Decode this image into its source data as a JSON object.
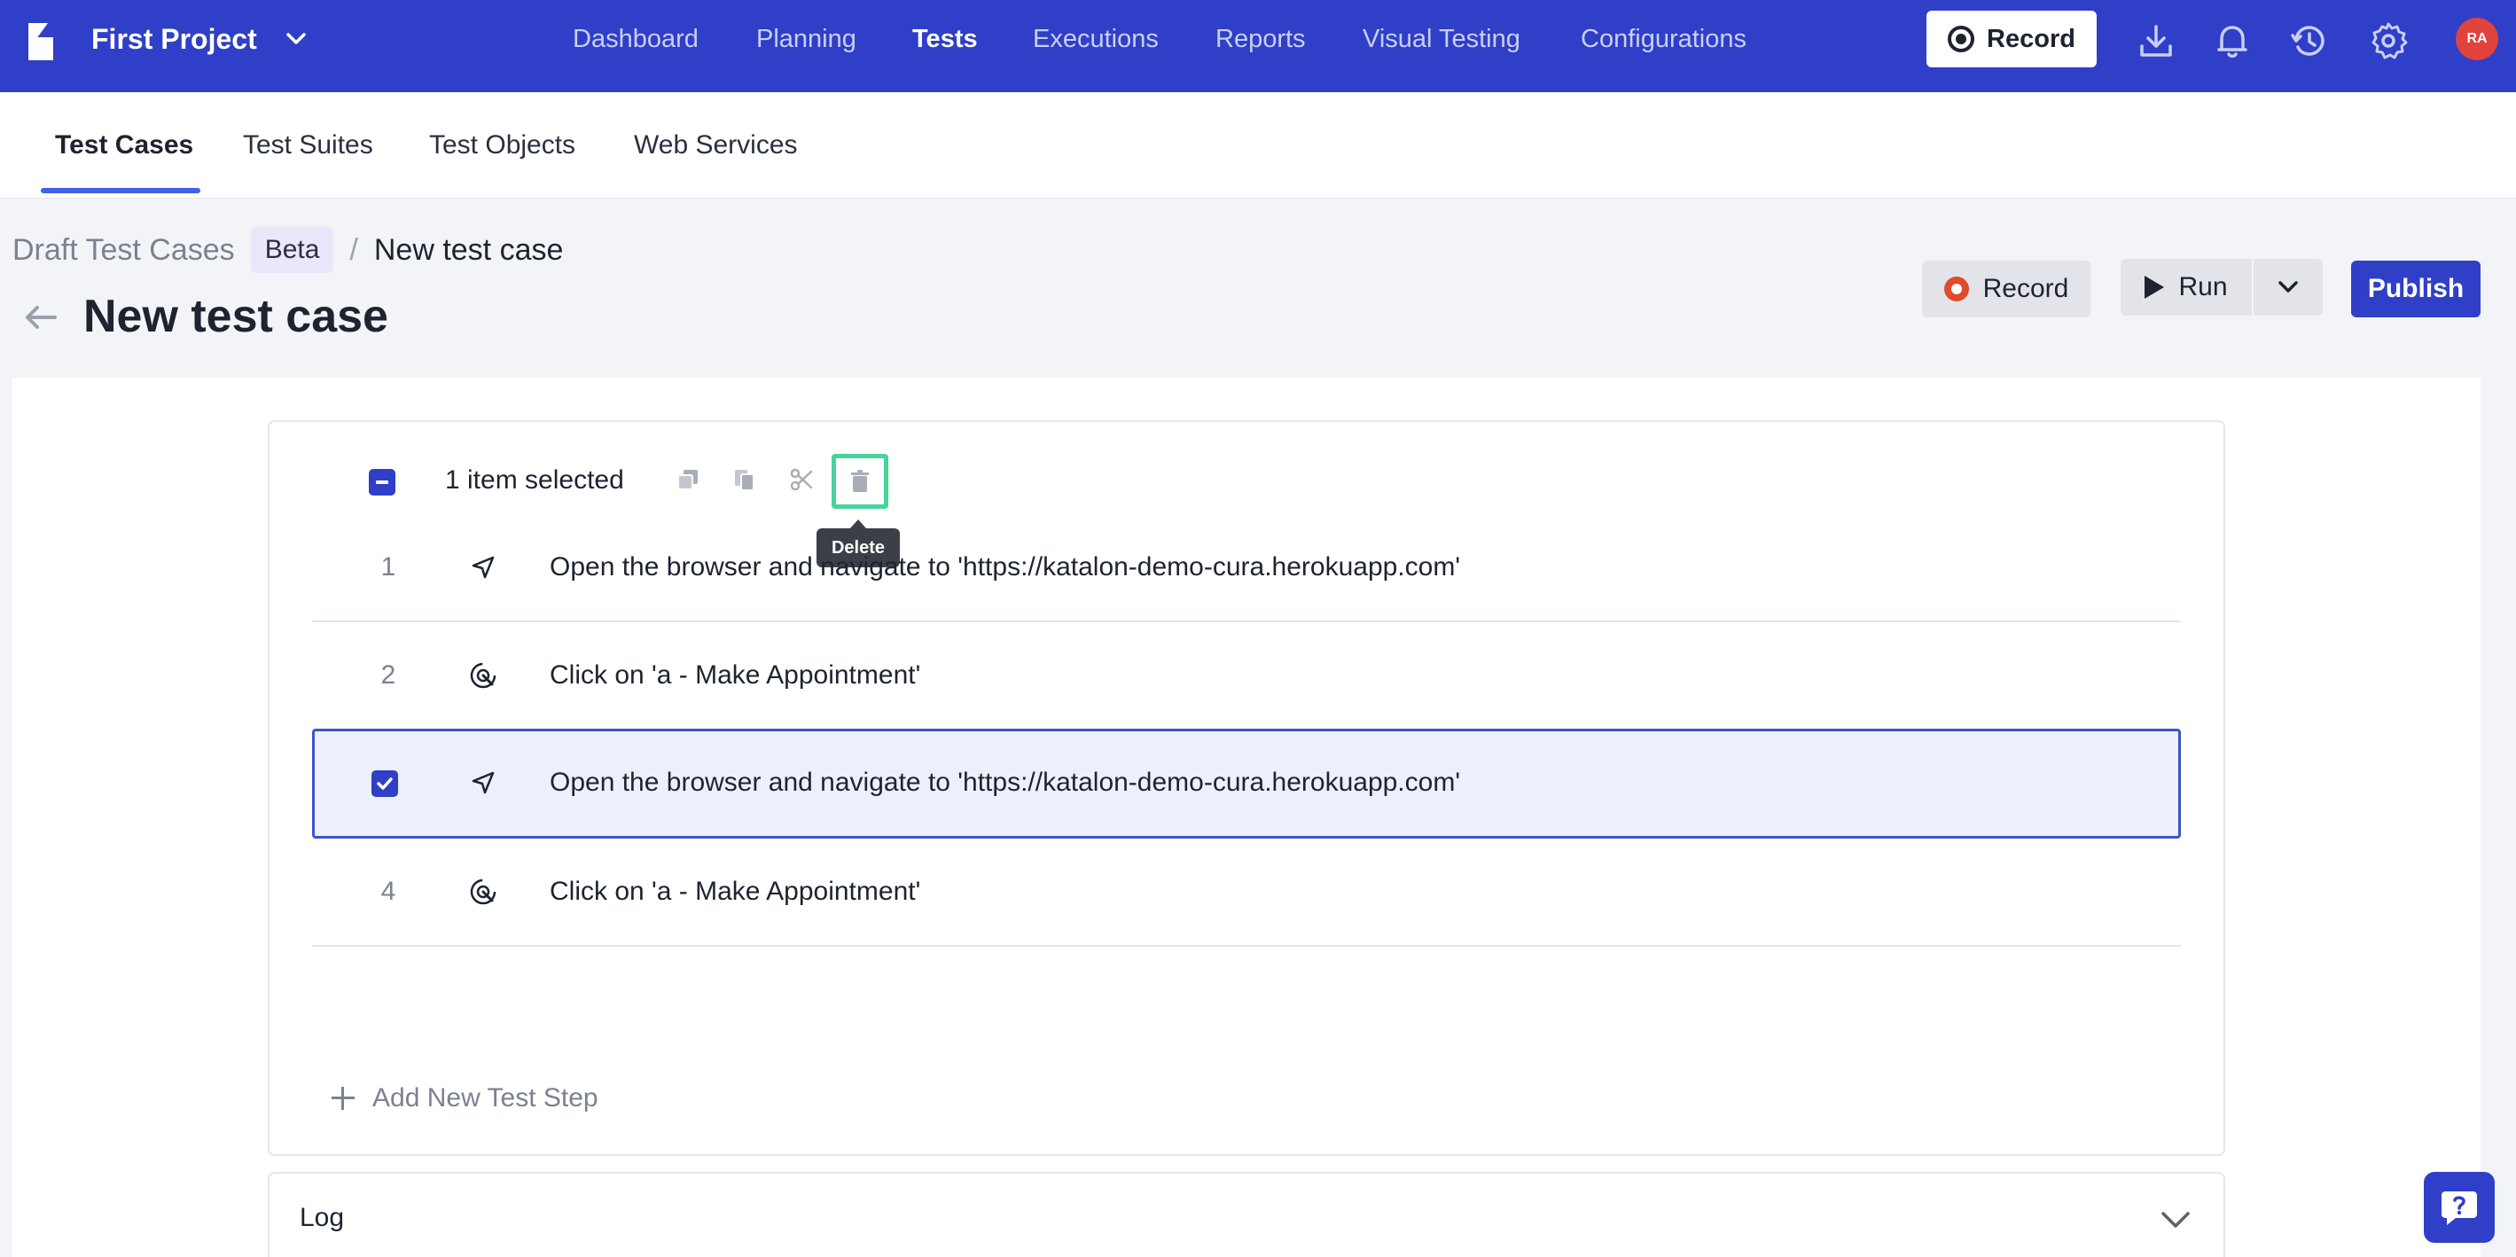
{
  "header": {
    "project_name": "First Project",
    "nav": [
      "Dashboard",
      "Planning",
      "Tests",
      "Executions",
      "Reports",
      "Visual Testing",
      "Configurations"
    ],
    "active_nav": "Tests",
    "record_label": "Record",
    "avatar_initials": "RA",
    "brand_color": "#2f3fc7"
  },
  "subtabs": [
    "Test Cases",
    "Test Suites",
    "Test Objects",
    "Web Services"
  ],
  "breadcrumb": {
    "root": "Draft Test Cases",
    "badge": "Beta",
    "separator": "/",
    "current": "New test case"
  },
  "page": {
    "title": "New test case",
    "record_label": "Record",
    "run_label": "Run",
    "publish_label": "Publish"
  },
  "selection": {
    "text": "1 item selected",
    "tooltip": "Delete"
  },
  "steps": [
    {
      "number": "1",
      "icon": "navigate-icon",
      "text": "Open the browser and navigate to 'https://katalon-demo-cura.herokuapp.com'",
      "selected": false
    },
    {
      "number": "2",
      "icon": "click-icon",
      "text": "Click on 'a - Make Appointment'",
      "selected": false
    },
    {
      "number": "",
      "icon": "navigate-icon",
      "text": "Open the browser and navigate to 'https://katalon-demo-cura.herokuapp.com'",
      "selected": true
    },
    {
      "number": "4",
      "icon": "click-icon",
      "text": "Click on 'a - Make Appointment'",
      "selected": false
    }
  ],
  "add_step_label": "Add New Test Step",
  "log_label": "Log"
}
